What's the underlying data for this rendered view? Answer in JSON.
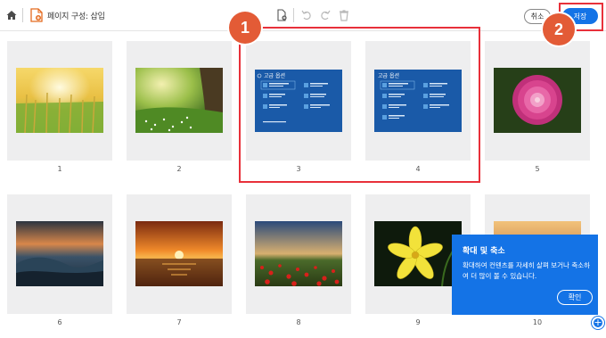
{
  "toolbar": {
    "title": "페이지 구성: 삽입",
    "cancel_label": "취소",
    "save_label": "저장"
  },
  "pages": [
    {
      "number": "1",
      "image": "wheat-field-sunrise"
    },
    {
      "number": "2",
      "image": "meadow-with-tree"
    },
    {
      "number": "3",
      "image": "advanced-options-screen"
    },
    {
      "number": "4",
      "image": "advanced-options-screen"
    },
    {
      "number": "5",
      "image": "pink-dahlia"
    },
    {
      "number": "6",
      "image": "ocean-wave-sunset"
    },
    {
      "number": "7",
      "image": "orange-sea-sunset"
    },
    {
      "number": "8",
      "image": "red-poppy-field"
    },
    {
      "number": "9",
      "image": "yellow-lily"
    },
    {
      "number": "10",
      "image": "autumn-scene"
    }
  ],
  "doc_thumb": {
    "heading": "고급 옵션"
  },
  "annotations": {
    "badge1": "1",
    "badge2": "2",
    "color": "#e8303a"
  },
  "popup": {
    "title": "확대 및 축소",
    "body": "확대하여 컨텐츠를 자세히 살펴 보거나 축소하여 더 많이 볼 수 있습니다.",
    "ok_label": "확인"
  },
  "colors": {
    "accent": "#1473e6",
    "annotation_badge": "#e35b36"
  }
}
